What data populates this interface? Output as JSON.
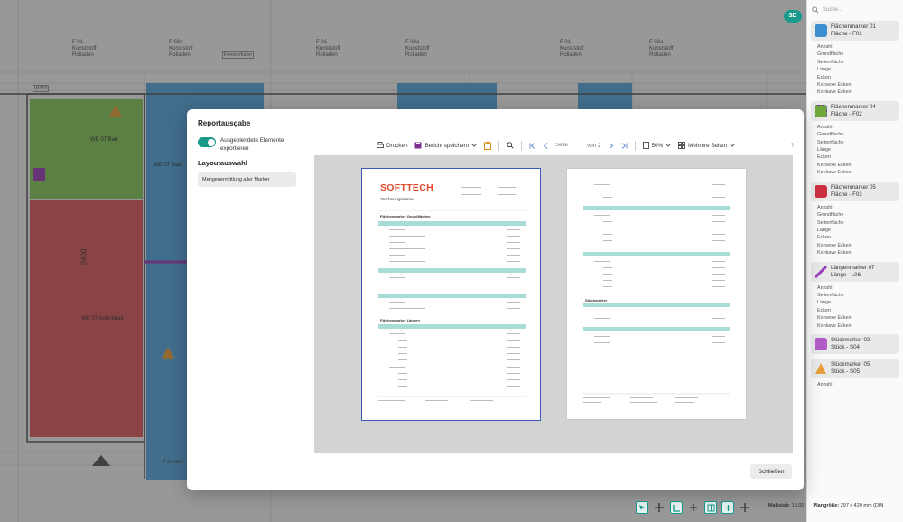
{
  "plan": {
    "badge_3d": "3D",
    "header_labels": [
      {
        "code": "F 01",
        "line1": "Kunststoff",
        "line2": "Rolladen"
      },
      {
        "code": "F 03a",
        "line1": "Kunststoff",
        "line2": "Rolladen"
      },
      {
        "code": "F 01",
        "line1": "Kunststoff",
        "line2": "Rolladen"
      },
      {
        "code": "F 03a",
        "line1": "Kunststoff",
        "line2": "Rolladen"
      },
      {
        "code": "F 01",
        "line1": "Kunststoff",
        "line2": "Rolladen"
      },
      {
        "code": "F 03a",
        "line1": "Kunststoff",
        "line2": "Rolladen"
      }
    ],
    "window_tag": "Fensterfutter",
    "wall_tag": "W333",
    "room_labels": [
      "WE 07 Bad",
      "WE 07 Bad",
      "WE 07 Aufenthalt",
      "2400"
    ],
    "bottom_tag": "Fenster"
  },
  "side_panel": {
    "search_placeholder": "Suche...",
    "markers": [
      {
        "title1": "Flächenmarker 01",
        "title2": "Fläche - F01",
        "color": "#3a8fd0",
        "props": [
          "Anzahl",
          "Grundfläche",
          "Seitenfläche",
          "Länge",
          "Ecken",
          "Konvexe Ecken",
          "Konkave Ecken"
        ]
      },
      {
        "title1": "Flächenmarker 04",
        "title2": "Fläche - F02",
        "color": "#6fa83a",
        "props": [
          "Anzahl",
          "Grundfläche",
          "Seitenfläche",
          "Länge",
          "Ecken",
          "Konvexe Ecken",
          "Konkave Ecken"
        ]
      },
      {
        "title1": "Flächenmarker 05",
        "title2": "Fläche - F03",
        "color": "#cc3040",
        "props": [
          "Anzahl",
          "Grundfläche",
          "Seitenfläche",
          "Länge",
          "Ecken",
          "Konvexe Ecken",
          "Konkave Ecken"
        ]
      },
      {
        "title1": "Längenmarker 07",
        "title2": "Länge - L06",
        "color": "#9b3fb8",
        "props": [
          "Anzahl",
          "Seitenfläche",
          "Länge",
          "Ecken",
          "Konvexe Ecken",
          "Konkave Ecken"
        ]
      },
      {
        "title1": "Stückmarker 02",
        "title2": "Stück - S04",
        "color": "#b35cc9",
        "props": []
      },
      {
        "title1": "Stückmarker 05",
        "title2": "Stück - S05",
        "color": "#e8a13a",
        "props": [
          "Anzahl"
        ]
      }
    ]
  },
  "bottom_bar": {
    "scale_label": "Maßstab:",
    "scale_value": "1:100",
    "plan_size_label": "Plangröße:",
    "plan_size_value": "297 x 420 mm (DIN"
  },
  "modal": {
    "title": "Reportausgabe",
    "toggle_label": "Ausgeblendete Elemente exportieren",
    "layout_heading": "Layoutauswahl",
    "layout_item": "Mengenermittlung aller Marker",
    "toolbar": {
      "print": "Drucken",
      "save": "Bericht speichern",
      "page_placeholder": "Seite",
      "page_of": "von 2",
      "zoom": "50%",
      "view_mode": "Mehrere Seiten",
      "help": "?"
    },
    "report": {
      "logo": "SOFTTECH",
      "logo_prefix": "SO",
      "heading": "Zeichnungsname",
      "section": "Flächenmarker Grundflächen",
      "section2": "Flächenmarker Längen",
      "section3": "Stückmarker"
    },
    "close_label": "Schließen"
  }
}
